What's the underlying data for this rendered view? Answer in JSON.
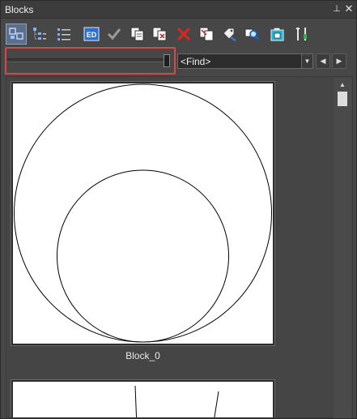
{
  "window": {
    "title": "Blocks",
    "pin_glyph": "⊥",
    "close_glyph": "✕"
  },
  "toolbar": {
    "tools": [
      {
        "name": "large-icons-view-icon",
        "active": true
      },
      {
        "name": "tree-view-icon",
        "active": false
      },
      {
        "name": "list-view-icon",
        "active": false
      },
      {
        "name": "edit-block-icon",
        "label": "ED",
        "active": false
      },
      {
        "name": "checkmark-icon",
        "active": false
      },
      {
        "name": "copy-block-icon",
        "active": false
      },
      {
        "name": "paste-block-icon",
        "active": false
      },
      {
        "name": "delete-icon",
        "active": false
      },
      {
        "name": "rename-block-icon",
        "active": false
      },
      {
        "name": "tag-icon",
        "active": false
      },
      {
        "name": "find-icon",
        "active": false
      },
      {
        "name": "insert-block-icon",
        "active": false
      },
      {
        "name": "settings-tools-icon",
        "active": false
      }
    ]
  },
  "size_slider": {
    "value_fraction": 0.98
  },
  "find": {
    "value": "<Find>",
    "prev_glyph": "◀",
    "next_glyph": "▶",
    "drop_glyph": "▼"
  },
  "blocks": [
    {
      "name": "Block_0"
    }
  ],
  "scrollbar": {
    "up_glyph": "▲",
    "thumb_position": 0.0
  }
}
